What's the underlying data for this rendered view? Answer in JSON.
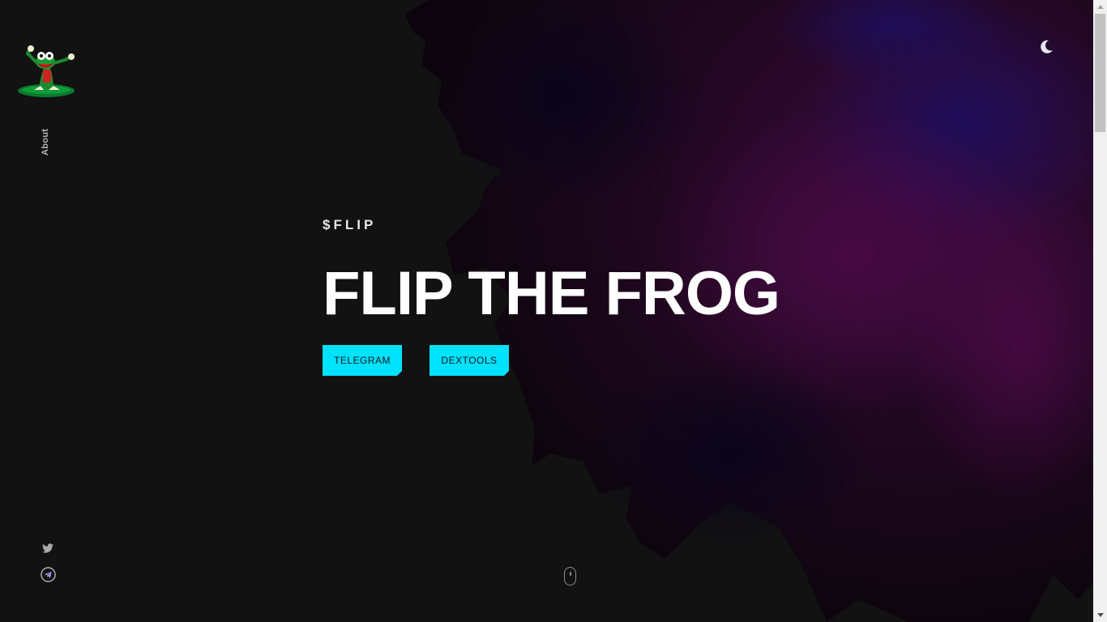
{
  "theme": {
    "background": "#121212",
    "accent": "#00e1fb",
    "title_color": "#ffffff",
    "scrollbar_track": "#f0f0f0",
    "scrollbar_thumb": "#c1c1c1"
  },
  "sidebar": {
    "logo_icon": "frog-mascot-logo",
    "nav": [
      {
        "label": "About"
      }
    ],
    "social": [
      {
        "icon": "twitter-icon"
      },
      {
        "icon": "telegram-icon"
      }
    ]
  },
  "header": {
    "theme_toggle_icon": "moon-icon"
  },
  "hero": {
    "kicker": "$FLIP",
    "title": "FLIP THE FROG",
    "buttons": [
      {
        "label": "TELEGRAM"
      },
      {
        "label": "DEXTOOLS"
      }
    ],
    "scroll_indicator_icon": "mouse-scroll-icon"
  }
}
